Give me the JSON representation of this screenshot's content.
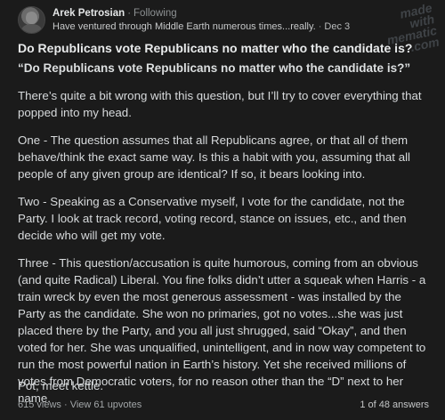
{
  "author": {
    "name": "Arek Petrosian",
    "follow_status": "Following",
    "credential": "Have ventured through Middle Earth numerous times...really.",
    "date": "Dec 3"
  },
  "watermark": "made with mematic .com",
  "question_title": "Do Republicans vote Republicans no matter who the candidate is?",
  "quoted_question": "“Do Republicans vote Republicans no matter who the candidate is?”",
  "paragraphs": [
    "There’s quite a bit wrong with this question, but I’ll try to cover everything that popped into my head.",
    "One - The question assumes that all Republicans agree, or that all of them behave/think the exact same way. Is this a habit with you, assuming that all people of any given group are identical? If so, it bears looking into.",
    "Two - Speaking as a Conservative myself, I vote for the candidate, not the Party. I look at track record, voting record, stance on issues, etc., and then decide who will get my vote.",
    "Three - This question/accusation is quite humorous, coming from an obvious (and quite Radical) Liberal. You fine folks didn’t utter a squeak when Harris - a train wreck by even the most generous assessment - was installed by the Party as the candidate. She won no primaries, got no votes...she was just placed there by the Party, and you all just shrugged, said “Okay”, and then voted for her. She was unqualified, unintelligent, and in now way competent to run the most powerful nation in Earth’s history. Yet she received millions of votes from Democratic voters, for no reason other than the “D” next to her name.",
    "Pot, meet kettle."
  ],
  "stats": {
    "views": "615 views",
    "upvotes": "View 61 upvotes",
    "answer_count": "1 of 48 answers"
  }
}
